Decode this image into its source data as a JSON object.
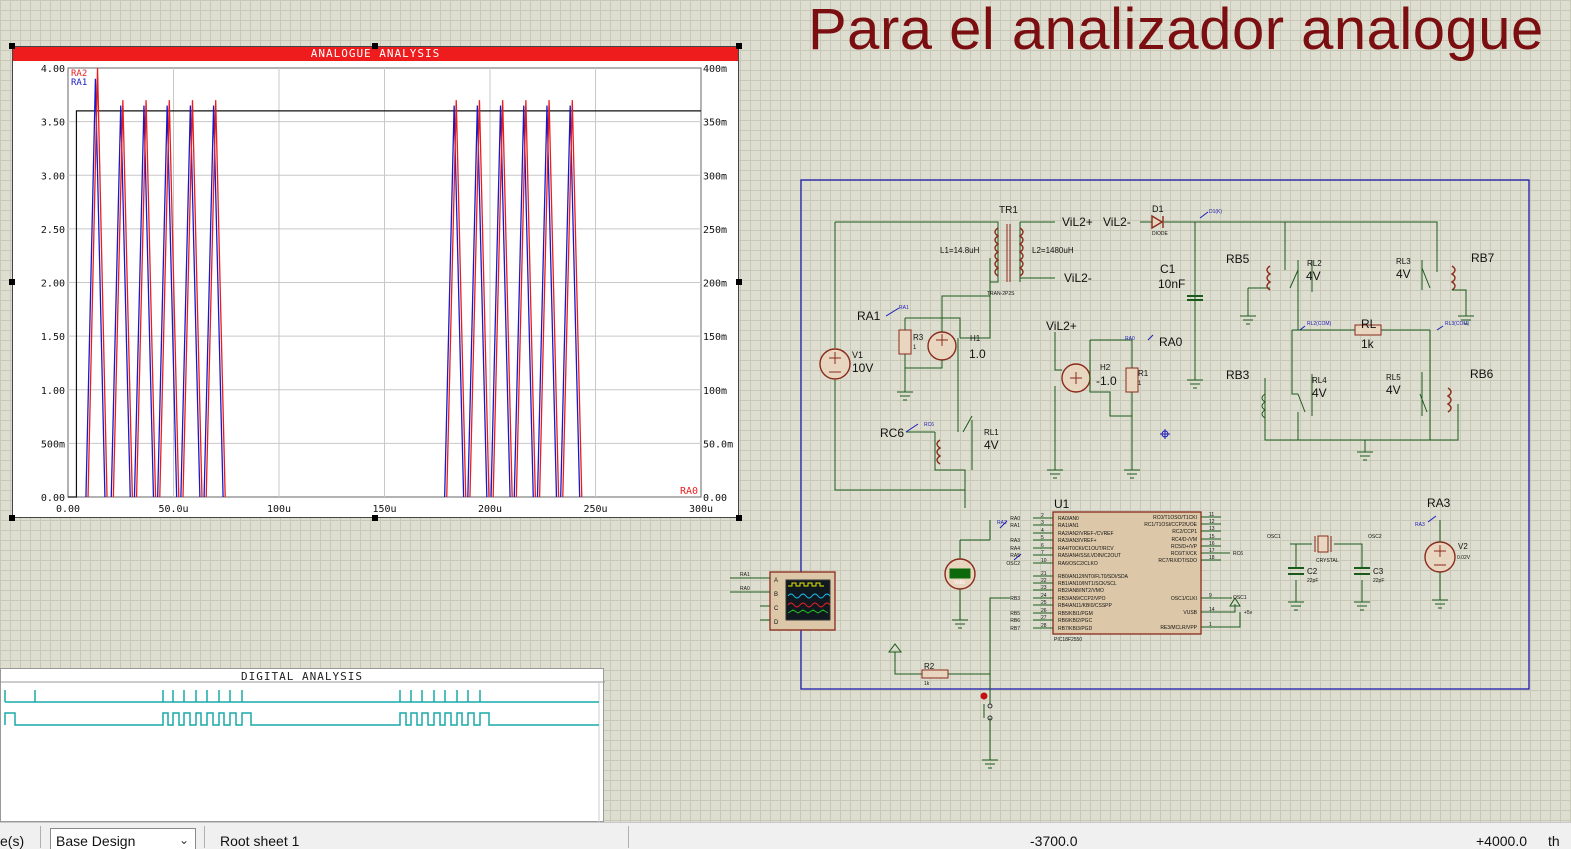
{
  "headline": "Para el analizador analogue",
  "analogue_graph": {
    "title": "ANALOGUE ANALYSIS",
    "left_ticks": [
      "4.00",
      "3.50",
      "3.00",
      "2.50",
      "2.00",
      "1.50",
      "1.00",
      "500m",
      "0.00"
    ],
    "right_ticks": [
      "400m",
      "350m",
      "300m",
      "250m",
      "200m",
      "150m",
      "100m",
      "50.0m",
      "0.00"
    ],
    "x_ticks": [
      "0.00",
      "50.0u",
      "100u",
      "150u",
      "200u",
      "250u",
      "300u"
    ],
    "trace_labels": [
      "RA2",
      "RA1"
    ],
    "right_trace_label": "RA0",
    "colors": {
      "ra2": "#e81e1e",
      "ra1": "#1818c8",
      "ra0": "#111111",
      "titlebar": "#ee1c1c"
    }
  },
  "chart_data": {
    "type": "line",
    "title": "ANALOGUE ANALYSIS",
    "x_unit": "s",
    "xlim": [
      0,
      0.0003
    ],
    "ylim_left": [
      0,
      4.0
    ],
    "ylim_right": [
      0,
      0.4
    ],
    "grid": true,
    "series": [
      {
        "name": "RA2",
        "axis": "left",
        "pulse_peaks_x_us": [
          14,
          26,
          37,
          48,
          59,
          70
        ],
        "pulse_peaks_y": [
          4.0,
          3.7,
          3.7,
          3.7,
          3.7,
          3.7
        ],
        "burst2_peaks_x_us": [
          184,
          195,
          206,
          217,
          228,
          239
        ],
        "burst2_peaks_y": [
          3.7,
          3.7,
          3.7,
          3.7,
          3.7,
          3.7
        ]
      },
      {
        "name": "RA1",
        "axis": "left",
        "pulse_peaks_x_us": [
          13,
          25,
          36,
          47,
          58,
          69
        ],
        "pulse_peaks_y": [
          3.9,
          3.65,
          3.65,
          3.65,
          3.65,
          3.65
        ],
        "burst2_peaks_x_us": [
          183,
          194,
          205,
          216,
          227,
          238
        ],
        "burst2_peaks_y": [
          3.65,
          3.65,
          3.65,
          3.65,
          3.65,
          3.65
        ]
      },
      {
        "name": "RA0",
        "axis": "right",
        "x_us": [
          0,
          4,
          4,
          300
        ],
        "y": [
          0,
          0,
          0.36,
          0.36
        ]
      }
    ]
  },
  "digital_graph": {
    "title": "DIGITAL ANALYSIS"
  },
  "schematic": {
    "labels": {
      "tr1": "TR1",
      "l1": "L1=14.8uH",
      "l2": "L2=1480uH",
      "tran": "TRAN-2P2S",
      "vil2p_a": "ViL2+",
      "vil2m_a": "ViL2-",
      "vil2m_b": "ViL2-",
      "vil2p_b": "ViL2+",
      "d1": "D1",
      "diode": "DIODE",
      "d1k": "D1(K)",
      "c1": "C1",
      "c1v": "10nF",
      "rb5": "RB5",
      "rl2": "RL2",
      "rl2v": "4V",
      "rl3": "RL3",
      "rl3v": "4V",
      "rb7": "RB7",
      "rl2com": "RL2(COM)",
      "rl": "RL",
      "rlv": "1k",
      "rl3com": "RL3(COM)",
      "rb3": "RB3",
      "rl4": "RL4",
      "rl4v": "4V",
      "rl5": "RL5",
      "rl5v": "4V",
      "rb6": "RB6",
      "ra1": "RA1",
      "ra1small": "RA1",
      "r3": "R3",
      "r3v": "1",
      "h1": "H1",
      "h1v": "1.0",
      "v1": "V1",
      "v1v": "10V",
      "ra0small": "RA0",
      "ra0": "RA0",
      "h2": "H2",
      "h2v": "-1.0",
      "r1": "R1",
      "r1v": "1",
      "rc6": "RC6",
      "rc6small": "RC6",
      "rl1": "RL1",
      "rl1v": "4V",
      "u1": "U1",
      "chip": "PIC18F2550",
      "ra2small": "RA2",
      "ra3": "RA3",
      "ra3small": "RA3",
      "v2": "V2",
      "v2v": "0.02V",
      "c2": "C2",
      "c2v": "22pF",
      "c3": "C3",
      "c3v": "22pF",
      "crystal": "CRYSTAL",
      "osc1": "OSC1",
      "osc2": "OSC2",
      "r2": "R2",
      "r2v": "1k",
      "volts": "Volts",
      "scope_a": "A",
      "scope_b": "B",
      "scope_c": "C",
      "scope_d": "D",
      "scope_in_a": "RA1",
      "scope_in_b": "RA0",
      "plus5v": "+5v",
      "rc6pin": "RC6"
    },
    "chip_left_pins": [
      [
        "RA0/AN0",
        "2",
        "RA0"
      ],
      [
        "RA1/AN1",
        "3",
        "RA1"
      ],
      [
        "RA2/AN2/VREF-/CVREF",
        "4",
        ""
      ],
      [
        "RA3/AN3/VREF+",
        "5",
        "RA3"
      ],
      [
        "RA4/T0CKI/C1OUT/RCV",
        "6",
        "RA4"
      ],
      [
        "RA5/AN4/SS/LVDIN/C2OUT",
        "7",
        "RA5"
      ],
      [
        "RA6/OSC2/CLKO",
        "10",
        "OSC2"
      ],
      [
        "RB0/AN12/INT0/FLT0/SDI/SDA",
        "21",
        ""
      ],
      [
        "RB1/AN10/INT1/SCK/SCL",
        "22",
        ""
      ],
      [
        "RB2/AN8/INT2/VMO",
        "23",
        ""
      ],
      [
        "RB3/AN9/CCP2/VPO",
        "24",
        "RB3"
      ],
      [
        "RB4/AN11/KBI0/CSSPP",
        "25",
        ""
      ],
      [
        "RB5/KBI1/PGM",
        "26",
        "RB5"
      ],
      [
        "RB6/KBI2/PGC",
        "27",
        "RB6"
      ],
      [
        "RB7/KBI3/PGD",
        "28",
        "RB7"
      ]
    ],
    "chip_right_pins": [
      [
        "RC0/T1OSO/T1CKI",
        "11"
      ],
      [
        "RC1/T1OSI/CCP2/UOE",
        "12"
      ],
      [
        "RC2/CCP1",
        "13"
      ],
      [
        "RC4/D-/VM",
        "15"
      ],
      [
        "RC5/D+/VP",
        "16"
      ],
      [
        "RC6/TX/CK",
        "17"
      ],
      [
        "RC7/RX/DT/SDO",
        "18"
      ],
      [
        "OSC1/CLKI",
        "9"
      ],
      [
        "VUSB",
        "14"
      ],
      [
        "RE3/MCLR/VPP",
        "1"
      ]
    ]
  },
  "statusbar": {
    "left_partial": "e(s)",
    "variant": "Base Design",
    "sheet": "Root sheet 1",
    "coord_x": "-3700.0",
    "coord_y": "+4000.0",
    "unit": "th"
  }
}
